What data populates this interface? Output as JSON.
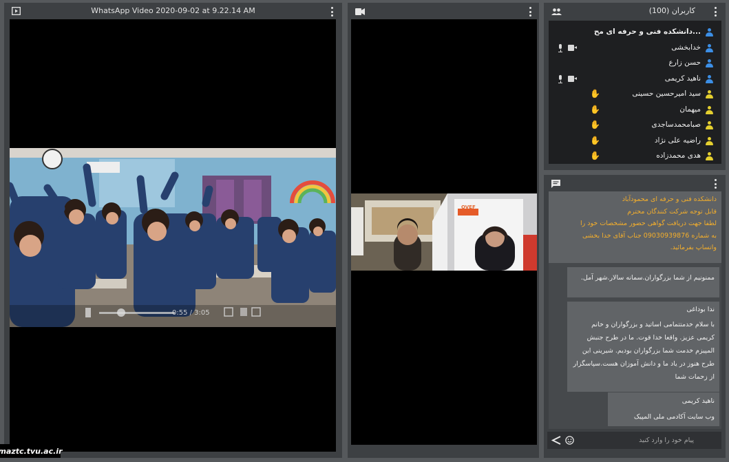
{
  "video_pod": {
    "title": "WhatsApp Video 2020-09-02 at 9.22.14 AM",
    "time_display": "0:55 / 3:05",
    "progress": 0.297
  },
  "camera_pod": {
    "banner_text": "OVEF"
  },
  "attendees_pod": {
    "title": "کاربران (100)",
    "users": [
      {
        "name": "دانشکده فنی و حرفه ای مح...",
        "role": "host",
        "mic": false,
        "cam": false,
        "hand": false
      },
      {
        "name": "خدابخشی",
        "role": "host",
        "mic": true,
        "cam": true,
        "hand": false
      },
      {
        "name": "حسن زارع",
        "role": "host",
        "mic": false,
        "cam": false,
        "hand": false
      },
      {
        "name": "ناهید کریمی",
        "role": "host",
        "mic": true,
        "cam": true,
        "hand": false
      },
      {
        "name": "سید امیرحسین حسینی",
        "role": "participant",
        "mic": false,
        "cam": false,
        "hand": true
      },
      {
        "name": "میهمان",
        "role": "participant",
        "mic": false,
        "cam": false,
        "hand": true
      },
      {
        "name": "صبامحمدساجدی",
        "role": "participant",
        "mic": false,
        "cam": false,
        "hand": true
      },
      {
        "name": "راضیه علی نژاد",
        "role": "participant",
        "mic": false,
        "cam": false,
        "hand": true
      },
      {
        "name": "هدی محمدزاده",
        "role": "participant",
        "mic": false,
        "cam": false,
        "hand": true
      }
    ],
    "colors": {
      "host": "#3c8fe6",
      "participant": "#e4cf2f"
    }
  },
  "chat_pod": {
    "messages": [
      {
        "sender": "",
        "lines": [
          "دانشکده فنی و حرفه ای محمودآباد",
          "قابل توجه شرکت کنندگان محترم",
          "لطفا جهت دریافت گواهی حضور مشخصات خود را",
          "به شماره 09030939876 جناب آقای خدا بخشی",
          "واتساپ بفرمائید."
        ]
      },
      {
        "sender": "",
        "lines": [
          "ممنونیم از شما بزرگواران.سمانه سالار.شهر آمل."
        ]
      },
      {
        "sender": "ندا بوداغی",
        "lines": [
          "با سلام خدمتتمامی اساتید و بزرگواران و خانم",
          "کریمی عزیز. واقعا خدا قوت. ما در طرح جنبش",
          "المپیزم خدمت شما بزرگواران بودیم. شیرینی این",
          "طرح هنوز در یاد ما و دانش آموزان هست.سپاسگزار",
          "از زحمات شما"
        ]
      },
      {
        "sender": "ناهید کریمی",
        "lines": [
          "وب سایت آکادمی ملی المپیک"
        ]
      }
    ],
    "input_placeholder": "پیام خود را وارد کنید"
  },
  "watermark": "maztc.tvu.ac.ir",
  "accent_colors": {
    "chat_highlight": "#f3ae2c",
    "pod_bg": "#3d4043",
    "stage_bg": "#56595c"
  }
}
